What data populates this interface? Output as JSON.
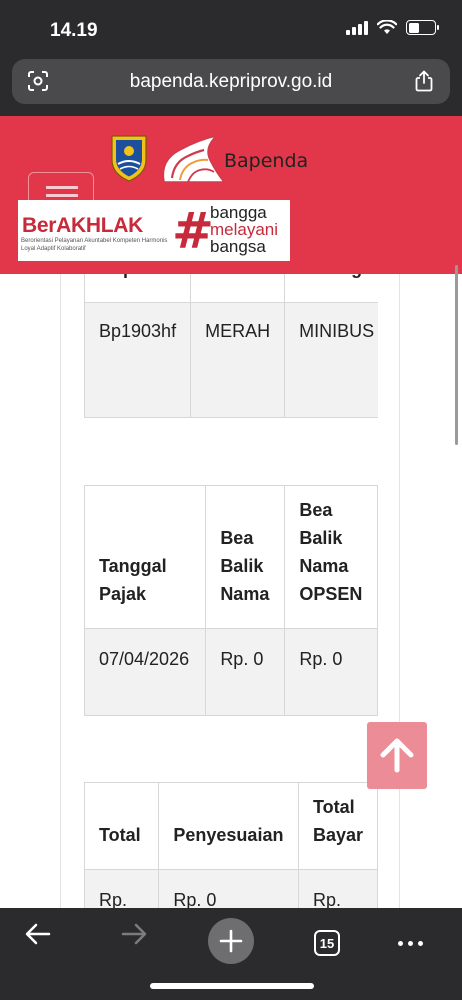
{
  "status_bar": {
    "time": "14.19"
  },
  "url_bar": {
    "domain": "bapenda.kepriprov.go.id"
  },
  "header": {
    "bapenda_logo_text": "Bapenda",
    "berakhlak_title": "BerAKHLAK",
    "berakhlak_subtitle": "Berorientasi Pelayanan Akuntabel Kompeten Harmonis Loyal Adaptif Kolaboratif",
    "hash": "#",
    "tagline_line1": "bangga",
    "tagline_line2": "melayani",
    "tagline_line3": "bangsa"
  },
  "table1": {
    "headers": [
      "Nopol",
      "Warna",
      "Golongan"
    ],
    "row": [
      "Bp1903hf",
      "MERAH",
      "MINIBUS"
    ]
  },
  "table2": {
    "headers": [
      "Tanggal Pajak",
      "Bea Balik Nama",
      "Bea Balik Nama OPSEN"
    ],
    "row": [
      "07/04/2026",
      "Rp. 0",
      "Rp. 0"
    ]
  },
  "table3": {
    "headers": [
      "Total",
      "Penyesuaian",
      "Total Bayar"
    ],
    "row": [
      "Rp.",
      "Rp. 0",
      "Rp."
    ]
  },
  "toolbar": {
    "tab_count": "15"
  },
  "colors": {
    "header_red": "#e2374a",
    "brand_red": "#c62a3b",
    "scroll_top_button": "#ec8c96",
    "chrome_dark": "#2b2b2d"
  },
  "icons": [
    "qr-scan-icon",
    "share-icon",
    "arrow-up-icon",
    "back-arrow-icon",
    "forward-arrow-icon",
    "plus-icon",
    "tabs-icon",
    "more-icon"
  ]
}
